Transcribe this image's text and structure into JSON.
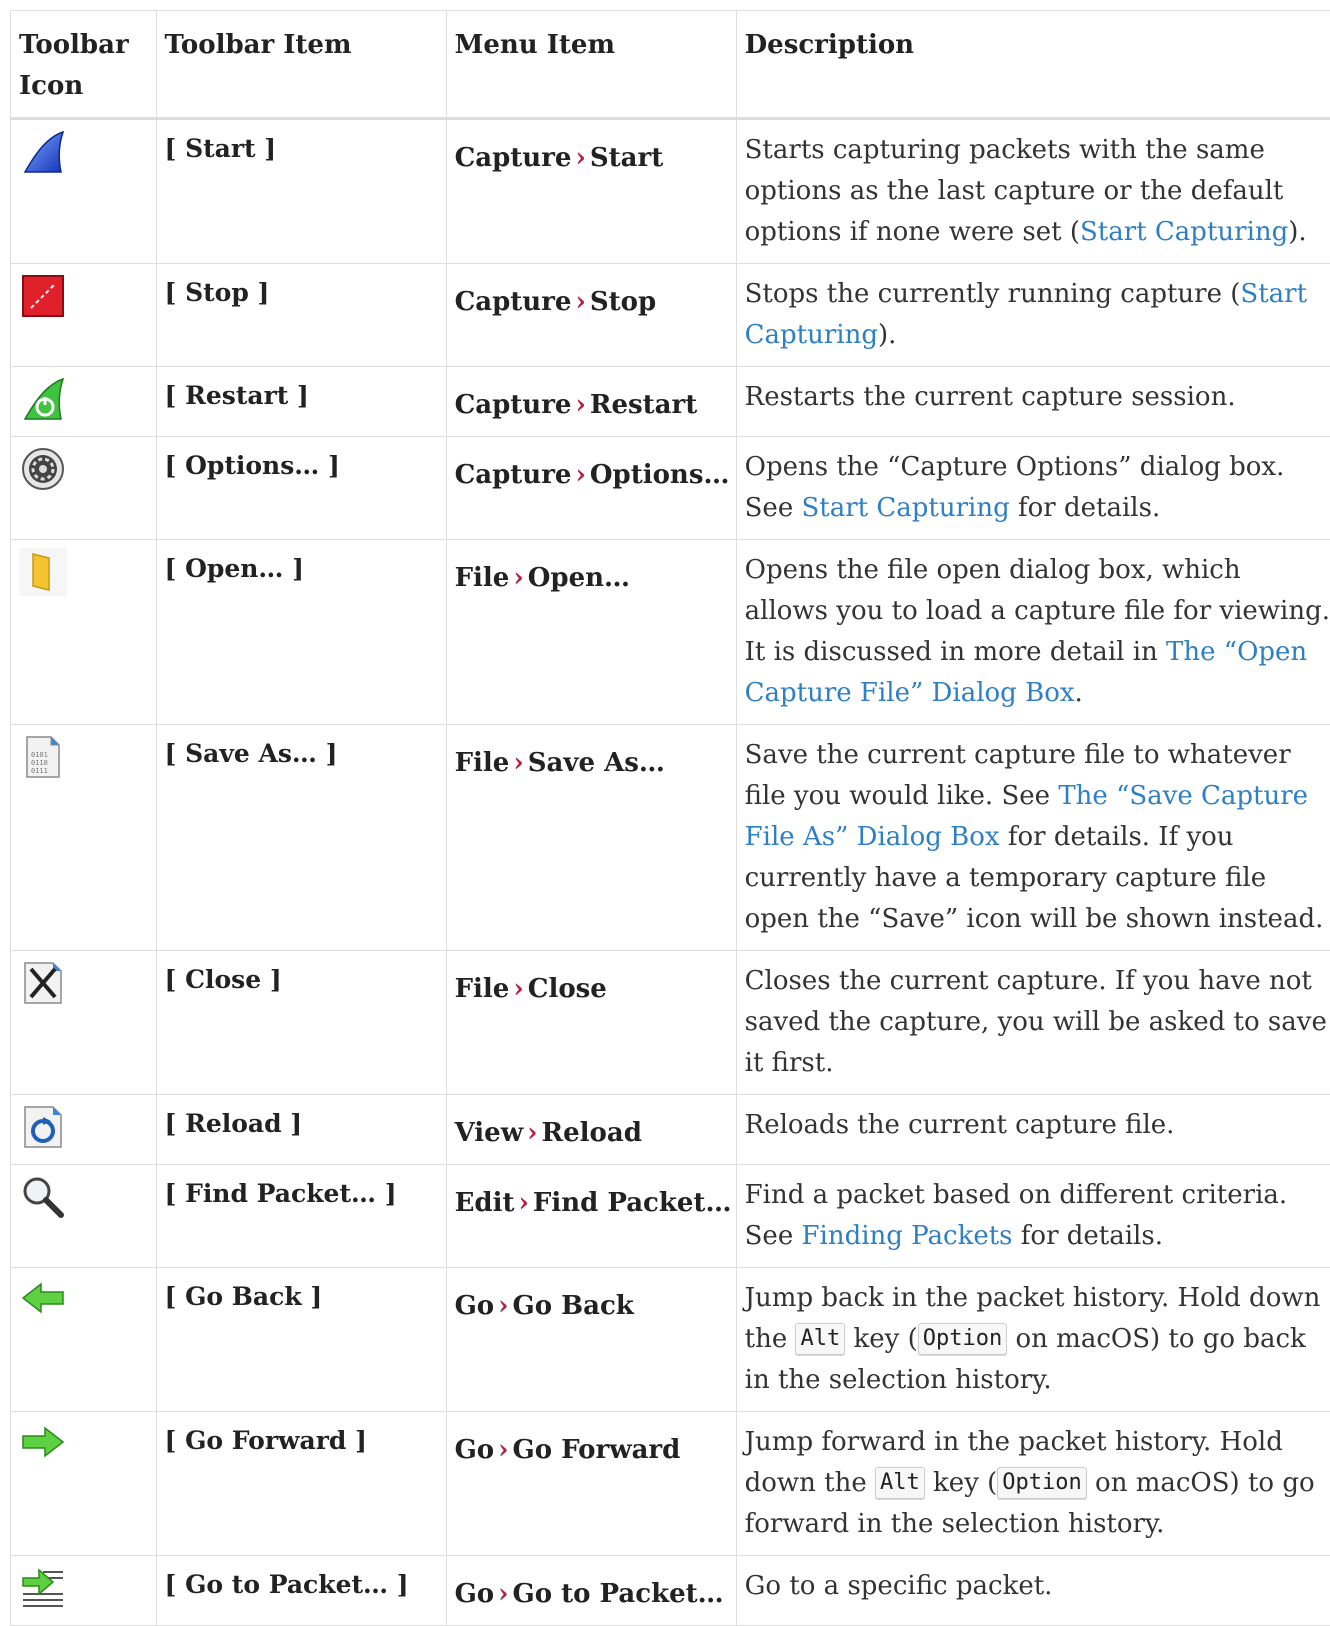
{
  "headers": {
    "icon": "Toolbar Icon",
    "item": "Toolbar Item",
    "menu": "Menu Item",
    "desc": "Description"
  },
  "menu_separator": "›",
  "rows": [
    {
      "icon": "shark-fin-start-icon",
      "item": "[ Start ]",
      "menu_parent": "Capture",
      "menu_child": "Start",
      "desc_pre": "Starts capturing packets with the same options as the last capture or the default options if none were set (",
      "desc_link": "Start Capturing",
      "desc_post": ")."
    },
    {
      "icon": "stop-icon",
      "item": "[ Stop ]",
      "menu_parent": "Capture",
      "menu_child": "Stop",
      "desc_pre": "Stops the currently running capture (",
      "desc_link": "Start Capturing",
      "desc_post": ")."
    },
    {
      "icon": "restart-icon",
      "item": "[ Restart ]",
      "menu_parent": "Capture",
      "menu_child": "Restart",
      "desc_pre": "Restarts the current capture session.",
      "desc_link": "",
      "desc_post": ""
    },
    {
      "icon": "gear-options-icon",
      "item": "[ Options… ]",
      "menu_parent": "Capture",
      "menu_child": "Options…",
      "desc_pre": "Opens the “Capture Options” dialog box. See ",
      "desc_link": "Start Capturing",
      "desc_post": " for details."
    },
    {
      "icon": "folder-open-icon",
      "item": "[ Open… ]",
      "menu_parent": "File",
      "menu_child": "Open…",
      "desc_pre": "Opens the file open dialog box, which allows you to load a capture file for viewing. It is discussed in more detail in ",
      "desc_link": "The “Open Capture File” Dialog Box",
      "desc_post": "."
    },
    {
      "icon": "save-as-file-icon",
      "item": "[ Save As… ]",
      "menu_parent": "File",
      "menu_child": "Save As…",
      "desc_pre": "Save the current capture file to whatever file you would like. See ",
      "desc_link": "The “Save Capture File As” Dialog Box",
      "desc_post": " for details. If you currently have a temporary capture file open the “Save” icon will be shown instead."
    },
    {
      "icon": "close-file-icon",
      "item": "[ Close ]",
      "menu_parent": "File",
      "menu_child": "Close",
      "desc_pre": "Closes the current capture. If you have not saved the capture, you will be asked to save it first.",
      "desc_link": "",
      "desc_post": ""
    },
    {
      "icon": "reload-icon",
      "item": "[ Reload ]",
      "menu_parent": "View",
      "menu_child": "Reload",
      "desc_pre": "Reloads the current capture file.",
      "desc_link": "",
      "desc_post": ""
    },
    {
      "icon": "magnifier-icon",
      "item": "[ Find Packet… ]",
      "menu_parent": "Edit",
      "menu_child": "Find Packet…",
      "desc_pre": "Find a packet based on different criteria. See ",
      "desc_link": "Finding Packets",
      "desc_post": " for details."
    },
    {
      "icon": "arrow-back-icon",
      "item": "[ Go Back ]",
      "menu_parent": "Go",
      "menu_child": "Go Back",
      "desc_pre": "Jump back in the packet history. Hold down the ",
      "kbd1": "Alt",
      "desc_mid": " key (",
      "kbd2": "Option",
      "desc_post": " on macOS) to go back in the selection history."
    },
    {
      "icon": "arrow-forward-icon",
      "item": "[ Go Forward ]",
      "menu_parent": "Go",
      "menu_child": "Go Forward",
      "desc_pre": "Jump forward in the packet history. Hold down the ",
      "kbd1": "Alt",
      "desc_mid": " key (",
      "kbd2": "Option",
      "desc_post": " on macOS) to go forward in the selection history."
    },
    {
      "icon": "go-to-packet-icon",
      "item": "[ Go to Packet… ]",
      "menu_parent": "Go",
      "menu_child": "Go to Packet…",
      "desc_pre": "Go to a specific packet.",
      "desc_link": "",
      "desc_post": ""
    }
  ]
}
